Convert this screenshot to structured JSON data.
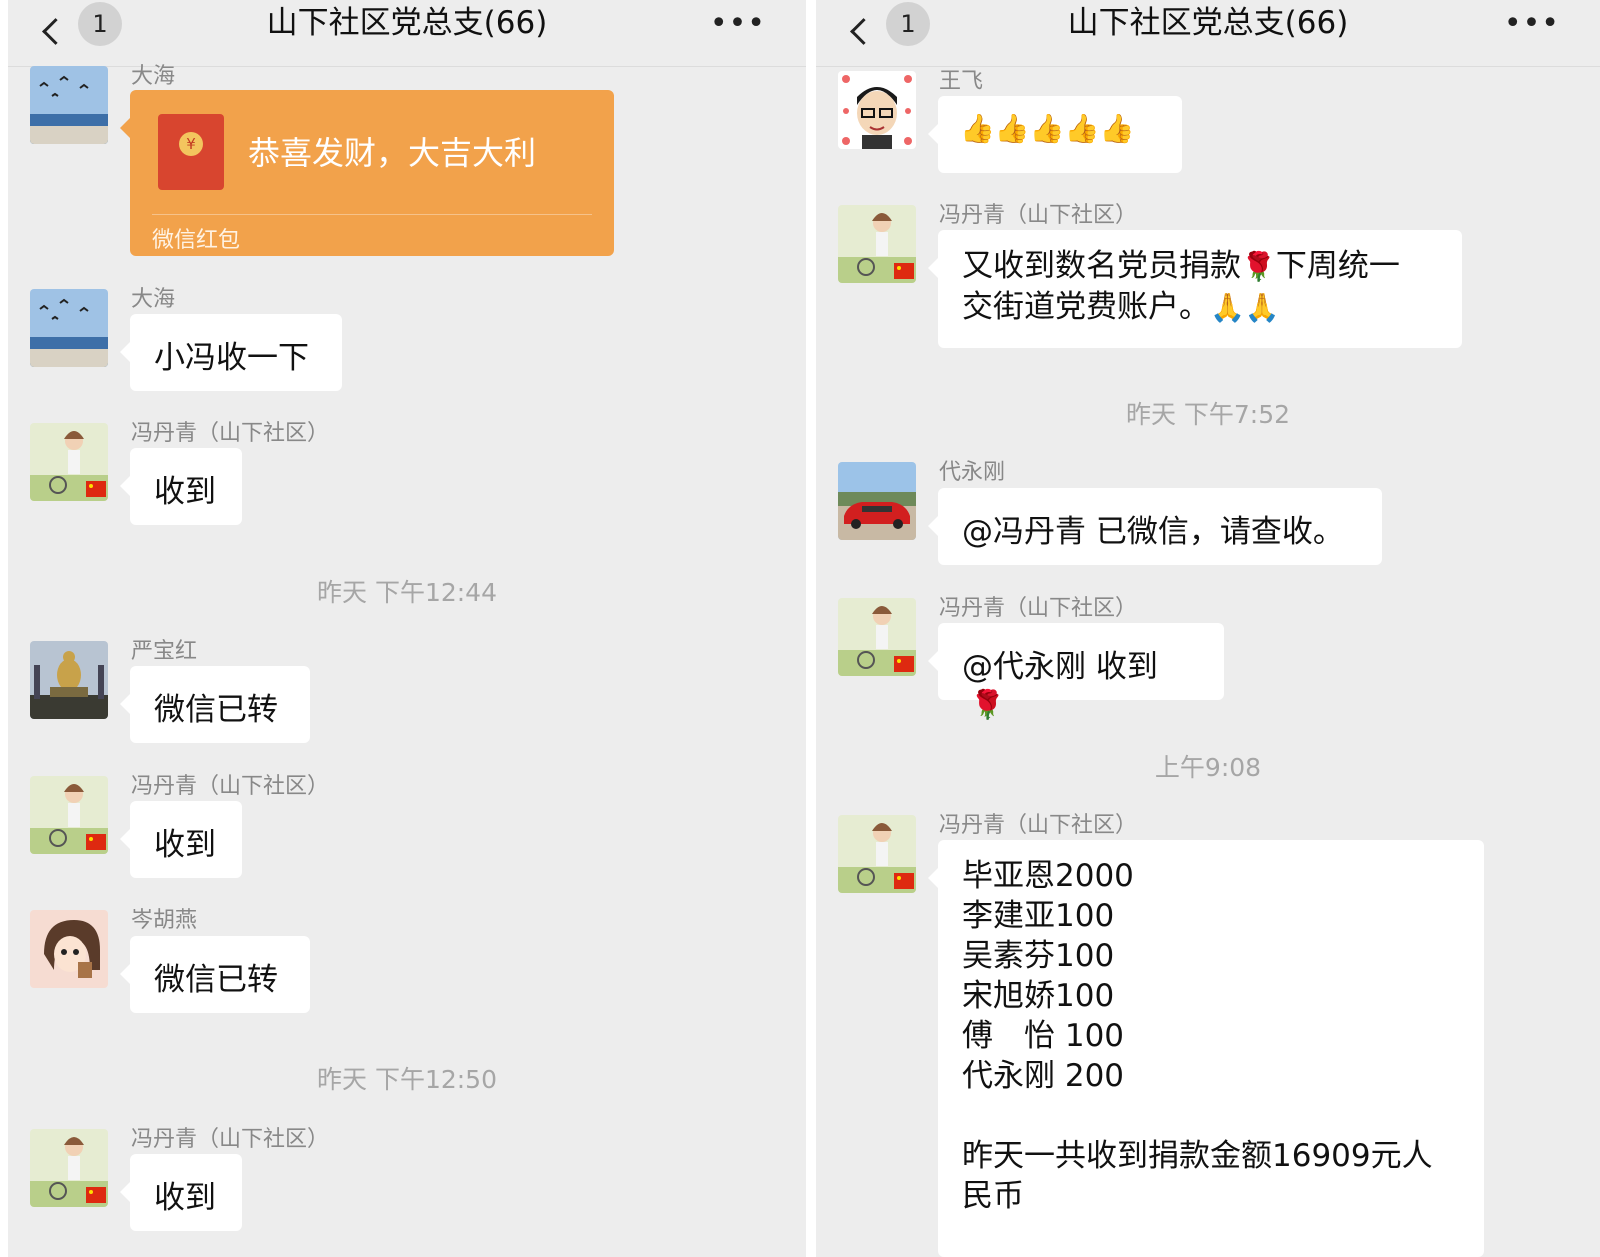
{
  "left_pane": {
    "back_badge": "1",
    "title": "山下社区党总支(66)",
    "more_label": "•••",
    "names": {
      "dahai_1": "大海",
      "dahai_2": "大海",
      "feng_1": "冯丹青（山下社区）",
      "yan": "严宝红",
      "feng_2": "冯丹青（山下社区）",
      "cen": "岑胡燕",
      "feng_3": "冯丹青（山下社区）"
    },
    "red_packet": {
      "title": "恭喜发财，大吉大利",
      "label": "微信红包",
      "coin": "¥"
    },
    "messages": {
      "dahai_text": "小冯收一下",
      "feng_1": "收到",
      "yan": "微信已转",
      "feng_2": "收到",
      "cen": "微信已转",
      "feng_3": "收到"
    },
    "timestamps": {
      "t1": "昨天 下午12:44",
      "t2": "昨天 下午12:50"
    }
  },
  "right_pane": {
    "back_badge": "1",
    "title": "山下社区党总支(66)",
    "more_label": "•••",
    "names": {
      "wang": "王飞",
      "feng_1": "冯丹青（山下社区）",
      "dai": "代永刚",
      "feng_2": "冯丹青（山下社区）",
      "feng_3": "冯丹青（山下社区）"
    },
    "messages": {
      "wang": "👍👍👍👍👍",
      "feng_1_line1": "又收到数名党员捐款",
      "feng_1_rose": "🌹",
      "feng_1_line1b": "下周统一",
      "feng_1_line2": "交街道党费账户。",
      "feng_1_hands": "🙏🙏",
      "dai": "@冯丹青 已微信，请查收。",
      "feng_2": "@代永刚 收到",
      "feng_2_rose": "🌹",
      "donation_list": "毕亚恩2000\n李建亚100\n吴素芬100\n宋旭娇100\n傅　怡 100\n代永刚 200\n\n昨天一共收到捐款金额16909元人\n民币"
    },
    "timestamps": {
      "t1": "昨天 下午7:52",
      "t2": "上午9:08"
    }
  }
}
